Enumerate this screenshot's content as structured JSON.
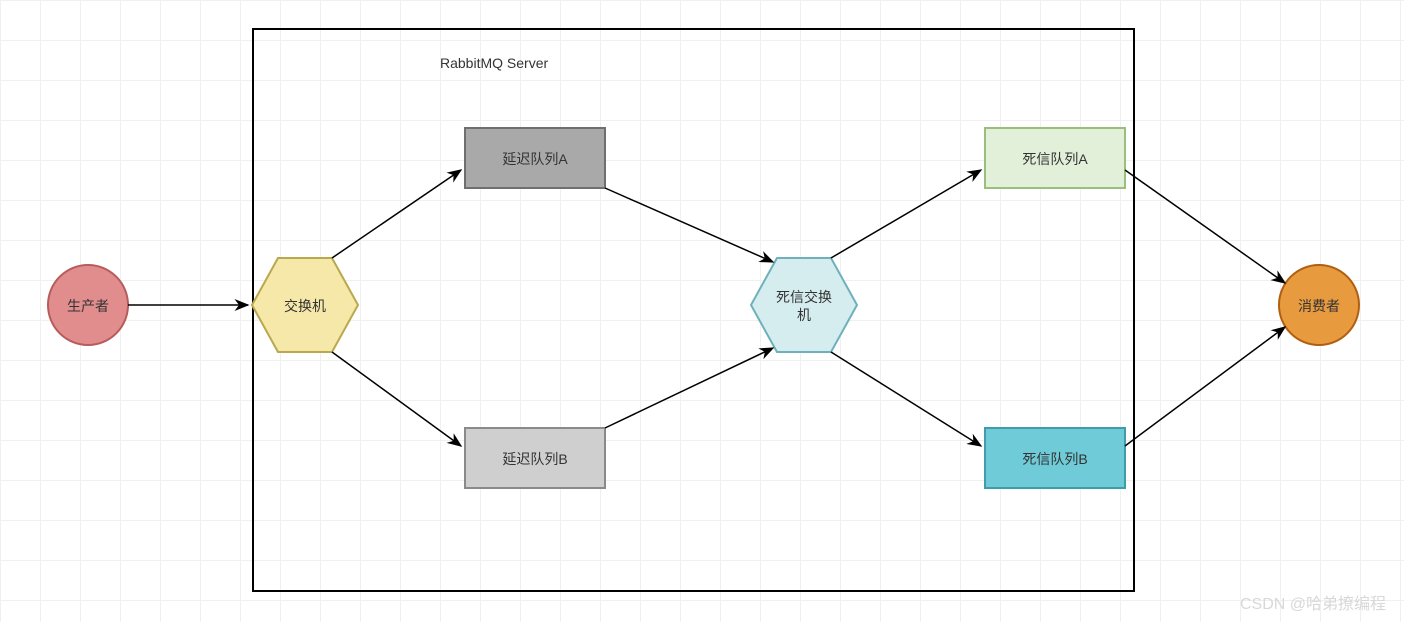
{
  "title": "RabbitMQ Server",
  "nodes": {
    "producer": "生产者",
    "exchange": "交换机",
    "delayQueueA": "延迟队列A",
    "delayQueueB": "延迟队列B",
    "deadExchange_l1": "死信交换",
    "deadExchange_l2": "机",
    "deadQueueA": "死信队列A",
    "deadQueueB": "死信队列B",
    "consumer": "消费者"
  },
  "colors": {
    "producer_fill": "#e28d8d",
    "producer_stroke": "#b85b5b",
    "exchange_fill": "#f5e8a8",
    "exchange_stroke": "#b9a84d",
    "delayA_fill": "#a9a9a9",
    "delayA_stroke": "#6f6f6f",
    "delayB_fill": "#cfcfcf",
    "delayB_stroke": "#8a8a8a",
    "deadEx_fill": "#d6edf0",
    "deadEx_stroke": "#6eb1bb",
    "deadA_fill": "#e2f0d9",
    "deadA_stroke": "#9abf7d",
    "deadB_fill": "#6fcbd8",
    "deadB_stroke": "#3f9da9",
    "consumer_fill": "#e89a3f",
    "consumer_stroke": "#b05f10",
    "container_stroke": "#000000",
    "arrow": "#000000"
  },
  "watermark": "CSDN @哈弟撩编程"
}
